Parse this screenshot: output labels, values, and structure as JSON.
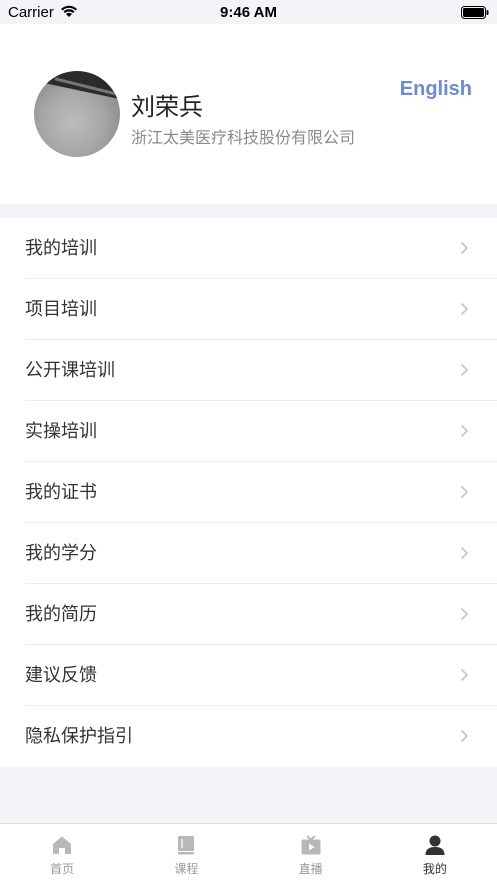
{
  "status_bar": {
    "carrier": "Carrier",
    "time": "9:46 AM"
  },
  "profile": {
    "name": "刘荣兵",
    "company": "浙江太美医疗科技股份有限公司",
    "language_link": "English"
  },
  "menu": {
    "items": [
      {
        "label": "我的培训"
      },
      {
        "label": "项目培训"
      },
      {
        "label": "公开课培训"
      },
      {
        "label": "实操培训"
      },
      {
        "label": "我的证书"
      },
      {
        "label": "我的学分"
      },
      {
        "label": "我的简历"
      },
      {
        "label": "建议反馈"
      },
      {
        "label": "隐私保护指引"
      }
    ]
  },
  "tab_bar": {
    "active": "我的",
    "tabs": [
      {
        "label": "首页",
        "icon": "home-icon"
      },
      {
        "label": "课程",
        "icon": "book-icon"
      },
      {
        "label": "直播",
        "icon": "live-tv-icon"
      },
      {
        "label": "我的",
        "icon": "user-icon"
      }
    ]
  },
  "colors": {
    "accent": "#6b8ad8",
    "active_tab": "#333333",
    "inactive_tab": "#b8b8b8",
    "page_bg": "#f4f4f8"
  }
}
